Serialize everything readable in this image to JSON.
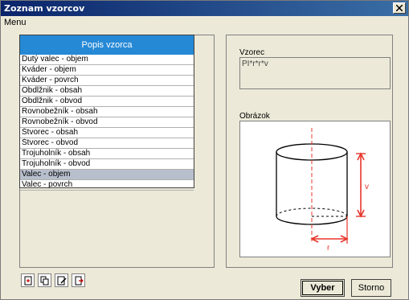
{
  "window": {
    "title": "Zoznam vzorcov"
  },
  "menubar": {
    "menu_label": "Menu"
  },
  "list": {
    "header": "Popis vzorca",
    "items": [
      "Dutý valec - objem",
      "Kváder - objem",
      "Kváder - povrch",
      "Obdĺžnik - obsah",
      "Obdĺžnik - obvod",
      "Rovnobežník - obsah",
      "Rovnobežník - obvod",
      "Štvorec - obsah",
      "Štvorec - obvod",
      "Trojuholník - obsah",
      "Trojuholník - obvod",
      "Valec - objem",
      "Valec - povrch"
    ],
    "selected_item": "Valec - objem"
  },
  "formula": {
    "label": "Vzorec",
    "value": "PI*r*r*v"
  },
  "picture": {
    "label": "Obrázok",
    "height_label": "v",
    "radius_label": "r",
    "accent_color": "#e8352b"
  },
  "buttons": {
    "select": "Vyber",
    "cancel": "Storno"
  },
  "toolbar": {
    "icons": [
      "new-icon",
      "copy-icon",
      "edit-icon",
      "delete-icon"
    ]
  }
}
